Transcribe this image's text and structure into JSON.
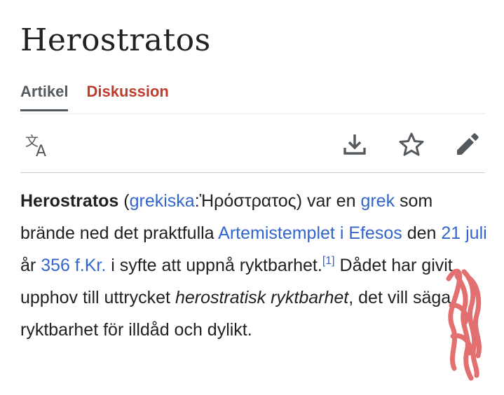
{
  "page_title": "Herostratos",
  "tabs": [
    {
      "label": "Artikel",
      "active": true
    },
    {
      "label": "Diskussion",
      "active": false
    }
  ],
  "toolbar": {
    "icons": [
      "translate-icon",
      "download-icon",
      "star-icon",
      "edit-pencil-icon"
    ]
  },
  "article": {
    "t01": "Herostratos",
    "t02": " (",
    "t03": "grekiska",
    "t04": ":",
    "t05": "Ἡρόστρατος",
    "t06": ") var en ",
    "t07": "grek",
    "t08": " som brände ned det praktfulla ",
    "t09": "Artemistemplet i Efesos",
    "t10": " den ",
    "t11": "21 juli",
    "t12": " år ",
    "t13": "356 f.Kr.",
    "t14": " i syfte att uppnå ryktbarhet.",
    "t15": "[1]",
    "t16": " Dådet har givit upphov till uttrycket ",
    "t17": "herostratisk ryktbarhet",
    "t18": ", det vill säga ryktbarhet för illdåd och dylikt."
  },
  "colors": {
    "link": "#3366cc",
    "tab_inactive": "#bf3c2c",
    "tab_active": "#54595d",
    "text": "#202122",
    "scribble": "#e06060"
  }
}
